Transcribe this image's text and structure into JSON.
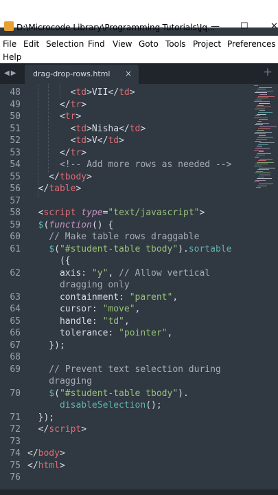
{
  "window": {
    "title": "D:\\Microcode Library\\Programming-Tutorials\\Jq...",
    "controls": [
      "—",
      "☐",
      "✕"
    ]
  },
  "menu": [
    "File",
    "Edit",
    "Selection",
    "Find",
    "View",
    "Goto",
    "Tools",
    "Project",
    "Preferences",
    "Help"
  ],
  "tabs": [
    {
      "label": "drag-drop-rows.html",
      "active": true,
      "close": "×"
    }
  ],
  "new_tab": "+",
  "editor": {
    "lines": [
      {
        "n": "48",
        "parts": [
          [
            "p",
            "        <"
          ],
          [
            "t",
            "td"
          ],
          [
            "p",
            ">VII</"
          ],
          [
            "t",
            "td"
          ],
          [
            "p",
            ">"
          ]
        ]
      },
      {
        "n": "49",
        "parts": [
          [
            "p",
            "      </"
          ],
          [
            "t",
            "tr"
          ],
          [
            "p",
            ">"
          ]
        ]
      },
      {
        "n": "50",
        "parts": [
          [
            "p",
            "      <"
          ],
          [
            "t",
            "tr"
          ],
          [
            "p",
            ">"
          ]
        ]
      },
      {
        "n": "51",
        "parts": [
          [
            "p",
            "        <"
          ],
          [
            "t",
            "td"
          ],
          [
            "p",
            ">Nisha</"
          ],
          [
            "t",
            "td"
          ],
          [
            "p",
            ">"
          ]
        ]
      },
      {
        "n": "52",
        "parts": [
          [
            "p",
            "        <"
          ],
          [
            "t",
            "td"
          ],
          [
            "p",
            ">V</"
          ],
          [
            "t",
            "td"
          ],
          [
            "p",
            ">"
          ]
        ]
      },
      {
        "n": "53",
        "parts": [
          [
            "p",
            "      </"
          ],
          [
            "t",
            "tr"
          ],
          [
            "p",
            ">"
          ]
        ]
      },
      {
        "n": "54",
        "parts": [
          [
            "c",
            "      <!-- Add more rows as needed -->"
          ]
        ]
      },
      {
        "n": "55",
        "parts": [
          [
            "p",
            "    </"
          ],
          [
            "t",
            "tbody"
          ],
          [
            "p",
            ">"
          ]
        ]
      },
      {
        "n": "56",
        "parts": [
          [
            "p",
            "  </"
          ],
          [
            "t",
            "table"
          ],
          [
            "p",
            ">"
          ]
        ]
      },
      {
        "n": "57",
        "parts": []
      },
      {
        "n": "58",
        "parts": [
          [
            "p",
            "  <"
          ],
          [
            "t",
            "script"
          ],
          [
            "p",
            " "
          ],
          [
            "k",
            "type"
          ],
          [
            "p",
            "="
          ],
          [
            "s",
            "\"text/javascript\""
          ],
          [
            "p",
            ">"
          ]
        ]
      },
      {
        "n": "59",
        "parts": [
          [
            "p",
            "  "
          ],
          [
            "f",
            "$"
          ],
          [
            "p",
            "("
          ],
          [
            "k",
            "function"
          ],
          [
            "p",
            "() {"
          ]
        ]
      },
      {
        "n": "60",
        "parts": [
          [
            "c",
            "    // Make table rows draggable"
          ]
        ]
      },
      {
        "n": "61",
        "parts": [
          [
            "p",
            "    "
          ],
          [
            "f",
            "$"
          ],
          [
            "p",
            "("
          ],
          [
            "s",
            "\"#student-table tbody\""
          ],
          [
            "p",
            ")."
          ],
          [
            "f",
            "sortable"
          ]
        ]
      },
      {
        "n": "",
        "parts": [
          [
            "p",
            "      ({"
          ]
        ]
      },
      {
        "n": "62",
        "parts": [
          [
            "p",
            "      axis: "
          ],
          [
            "s",
            "\"y\""
          ],
          [
            "p",
            ", "
          ],
          [
            "c",
            "// Allow vertical"
          ]
        ]
      },
      {
        "n": "",
        "parts": [
          [
            "c",
            "      dragging only"
          ]
        ]
      },
      {
        "n": "63",
        "parts": [
          [
            "p",
            "      containment: "
          ],
          [
            "s",
            "\"parent\""
          ],
          [
            "p",
            ","
          ]
        ]
      },
      {
        "n": "64",
        "parts": [
          [
            "p",
            "      cursor: "
          ],
          [
            "s",
            "\"move\""
          ],
          [
            "p",
            ","
          ]
        ]
      },
      {
        "n": "65",
        "parts": [
          [
            "p",
            "      handle: "
          ],
          [
            "s",
            "\"td\""
          ],
          [
            "p",
            ","
          ]
        ]
      },
      {
        "n": "66",
        "parts": [
          [
            "p",
            "      tolerance: "
          ],
          [
            "s",
            "\"pointer\""
          ],
          [
            "p",
            ","
          ]
        ]
      },
      {
        "n": "67",
        "parts": [
          [
            "p",
            "    });"
          ]
        ]
      },
      {
        "n": "68",
        "parts": []
      },
      {
        "n": "69",
        "parts": [
          [
            "c",
            "    // Prevent text selection during"
          ]
        ]
      },
      {
        "n": "",
        "parts": [
          [
            "c",
            "    dragging"
          ]
        ]
      },
      {
        "n": "70",
        "parts": [
          [
            "p",
            "    "
          ],
          [
            "f",
            "$"
          ],
          [
            "p",
            "("
          ],
          [
            "s",
            "\"#student-table tbody\""
          ],
          [
            "p",
            ")."
          ]
        ]
      },
      {
        "n": "",
        "parts": [
          [
            "p",
            "      "
          ],
          [
            "f",
            "disableSelection"
          ],
          [
            "p",
            "();"
          ]
        ]
      },
      {
        "n": "71",
        "parts": [
          [
            "p",
            "  });"
          ]
        ]
      },
      {
        "n": "72",
        "parts": [
          [
            "p",
            "  </"
          ],
          [
            "t",
            "script"
          ],
          [
            "p",
            ">"
          ]
        ]
      },
      {
        "n": "73",
        "parts": []
      },
      {
        "n": "74",
        "parts": [
          [
            "p",
            "</"
          ],
          [
            "t",
            "body"
          ],
          [
            "p",
            ">"
          ]
        ]
      },
      {
        "n": "75",
        "parts": [
          [
            "p",
            "</"
          ],
          [
            "t",
            "html"
          ],
          [
            "p",
            ">"
          ]
        ]
      },
      {
        "n": "76",
        "parts": []
      }
    ]
  },
  "colors": {
    "background": "#303841",
    "tag": "#e06c75",
    "string": "#98c379",
    "function": "#5fb3b3",
    "keyword": "#c594c5",
    "comment": "#a7adba"
  }
}
